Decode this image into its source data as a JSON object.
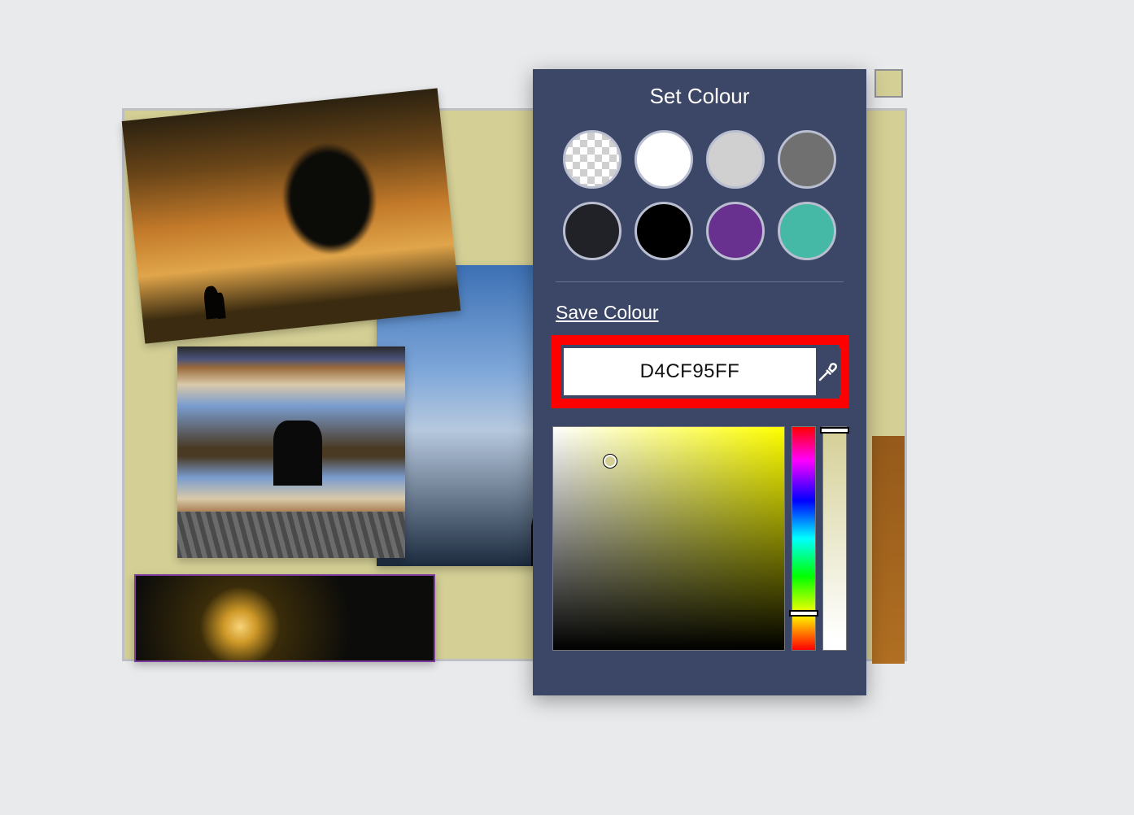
{
  "panel": {
    "title": "Set Colour",
    "save_label": "Save Colour",
    "hex_value": "D4CF95FF",
    "current_color": "#d4cf95",
    "swatches": [
      {
        "name": "transparent",
        "css": ""
      },
      {
        "name": "white",
        "css": "#ffffff"
      },
      {
        "name": "light-grey",
        "css": "#d0d0d0"
      },
      {
        "name": "grey",
        "css": "#707070"
      },
      {
        "name": "charcoal",
        "css": "#202227"
      },
      {
        "name": "black",
        "css": "#000000"
      },
      {
        "name": "purple",
        "css": "#69318f"
      },
      {
        "name": "teal",
        "css": "#45b9a6"
      }
    ]
  },
  "corner_swatch_color": "#d4cf95"
}
